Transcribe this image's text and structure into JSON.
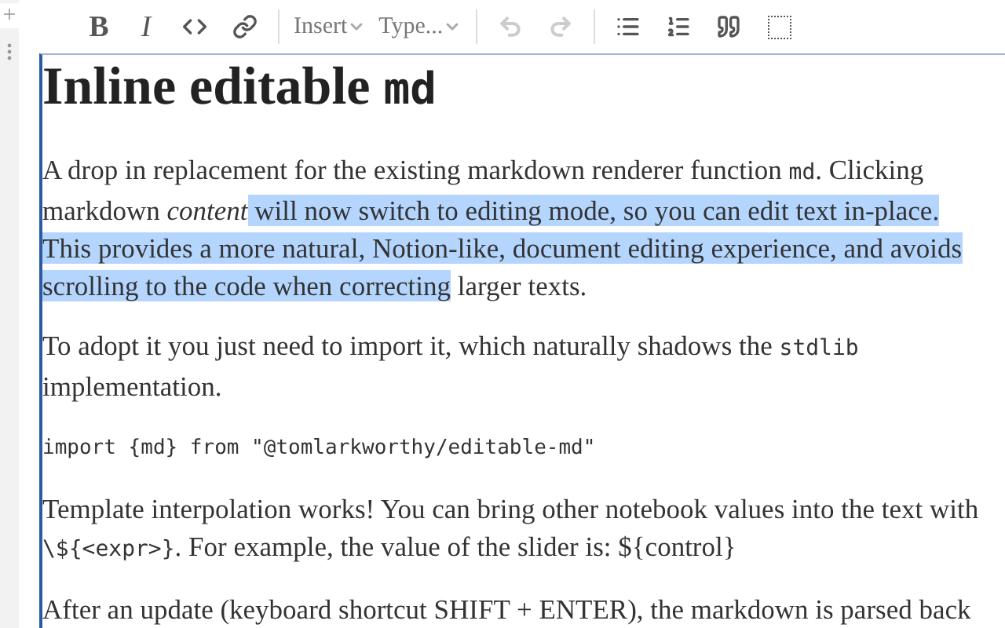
{
  "gutter": {
    "add": "+"
  },
  "toolbar": {
    "items": [
      {
        "kind": "text",
        "label": "B",
        "disabled": false
      },
      {
        "kind": "text",
        "label": "I",
        "disabled": false
      },
      {
        "kind": "icon",
        "disabled": false
      },
      {
        "kind": "icon",
        "disabled": false
      },
      {
        "kind": "divider"
      },
      {
        "kind": "menu",
        "label": "Insert",
        "disabled": false
      },
      {
        "kind": "menu",
        "label": "Type...",
        "disabled": false
      },
      {
        "kind": "divider"
      },
      {
        "kind": "icon",
        "disabled": true
      },
      {
        "kind": "icon",
        "disabled": true
      },
      {
        "kind": "divider"
      },
      {
        "kind": "icon",
        "disabled": false
      },
      {
        "kind": "icon",
        "disabled": false
      },
      {
        "kind": "icon",
        "disabled": false
      },
      {
        "kind": "icon",
        "disabled": false
      }
    ]
  },
  "heading": [
    {
      "text": "Inline editable ",
      "kind": "plain"
    },
    {
      "text": "md",
      "kind": "code"
    }
  ],
  "blocks": [
    {
      "kind": "paragraph",
      "segments": [
        {
          "text": "A drop in replacement for the existing markdown renderer function ",
          "kind": "plain",
          "selected": false
        },
        {
          "text": "md",
          "kind": "code",
          "selected": false
        },
        {
          "text": ". Clicking markdown ",
          "kind": "plain",
          "selected": false
        },
        {
          "text": "content",
          "kind": "emphasis",
          "selected": false
        },
        {
          "text": " will now switch to editing mode, so you can edit text in-place. This provides a more natural, Notion-like, document editing experience, and avoids scrolling to the code when correcting",
          "kind": "plain",
          "selected": true
        },
        {
          "text": " larger texts.",
          "kind": "plain",
          "selected": false
        }
      ]
    },
    {
      "kind": "paragraph",
      "segments": [
        {
          "text": "To adopt it you just need to import it, which naturally shadows the ",
          "kind": "plain",
          "selected": false
        },
        {
          "text": "stdlib",
          "kind": "code",
          "selected": false
        },
        {
          "text": " implementation.",
          "kind": "plain",
          "selected": false
        }
      ]
    },
    {
      "kind": "code",
      "segments": [
        {
          "text": "import {md} from \"@tomlarkworthy/editable-md\"",
          "kind": "plain",
          "selected": false
        }
      ]
    },
    {
      "kind": "paragraph",
      "segments": [
        {
          "text": "Template interpolation works! You can bring other notebook values into the text with ",
          "kind": "plain",
          "selected": false
        },
        {
          "text": "\\${<expr>}",
          "kind": "code",
          "selected": false
        },
        {
          "text": ". For example, the value of the slider is: ${control}",
          "kind": "plain",
          "selected": false
        }
      ]
    },
    {
      "kind": "paragraph",
      "segments": [
        {
          "text": "After an update (keyboard shortcut SHIFT + ENTER), the markdown is parsed back",
          "kind": "plain",
          "selected": false
        }
      ]
    }
  ]
}
